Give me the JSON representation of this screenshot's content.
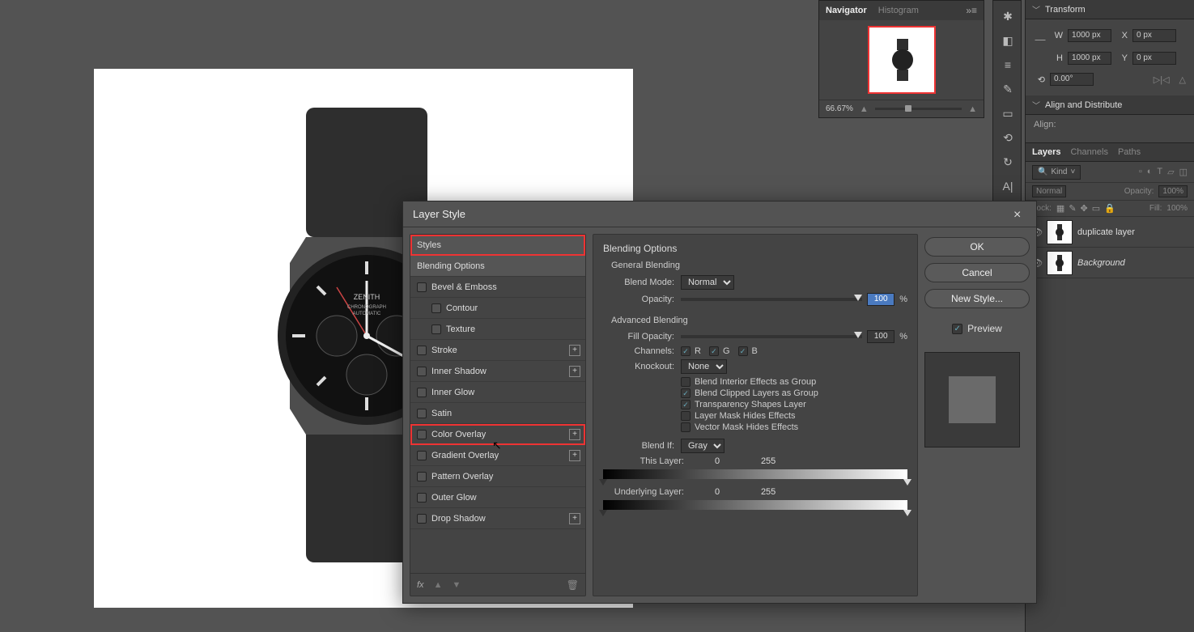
{
  "dialog": {
    "title": "Layer Style",
    "styles_label": "Styles",
    "blending_options_label": "Blending Options",
    "effects": {
      "bevel_emboss": "Bevel & Emboss",
      "contour": "Contour",
      "texture": "Texture",
      "stroke": "Stroke",
      "inner_shadow": "Inner Shadow",
      "inner_glow": "Inner Glow",
      "satin": "Satin",
      "color_overlay": "Color Overlay",
      "gradient_overlay": "Gradient Overlay",
      "pattern_overlay": "Pattern Overlay",
      "outer_glow": "Outer Glow",
      "drop_shadow": "Drop Shadow"
    },
    "fx_label": "fx",
    "options": {
      "section": "Blending Options",
      "general": "General Blending",
      "blend_mode_label": "Blend Mode:",
      "blend_mode_value": "Normal",
      "opacity_label": "Opacity:",
      "opacity_value": "100",
      "pct": "%",
      "advanced": "Advanced Blending",
      "fill_opacity_label": "Fill Opacity:",
      "fill_opacity_value": "100",
      "channels_label": "Channels:",
      "ch_r": "R",
      "ch_g": "G",
      "ch_b": "B",
      "knockout_label": "Knockout:",
      "knockout_value": "None",
      "blend_interior": "Blend Interior Effects as Group",
      "blend_clipped": "Blend Clipped Layers as Group",
      "transparency_shapes": "Transparency Shapes Layer",
      "layer_mask_hides": "Layer Mask Hides Effects",
      "vector_mask_hides": "Vector Mask Hides Effects",
      "blend_if_label": "Blend If:",
      "blend_if_value": "Gray",
      "this_layer": "This Layer:",
      "underlying": "Underlying Layer:",
      "range0": "0",
      "range1": "255"
    },
    "buttons": {
      "ok": "OK",
      "cancel": "Cancel",
      "new_style": "New Style...",
      "preview": "Preview"
    }
  },
  "navigator": {
    "tab_nav": "Navigator",
    "tab_hist": "Histogram",
    "zoom": "66.67%"
  },
  "transform": {
    "header": "Transform",
    "w_label": "W",
    "w_value": "1000 px",
    "h_label": "H",
    "h_value": "1000 px",
    "x_label": "X",
    "x_value": "0 px",
    "y_label": "Y",
    "y_value": "0 px",
    "angle_label": "⟲",
    "angle_value": "0.00°"
  },
  "align": {
    "header": "Align and Distribute",
    "label": "Align:"
  },
  "layers": {
    "tab_layers": "Layers",
    "tab_channels": "Channels",
    "tab_paths": "Paths",
    "kind": "Kind",
    "blend_mode": "Normal",
    "opacity_label": "Opacity:",
    "opacity_value": "100%",
    "lock_label": "Lock:",
    "fill_label": "Fill:",
    "fill_value": "100%",
    "layer1": "duplicate layer",
    "layer2": "Background"
  }
}
